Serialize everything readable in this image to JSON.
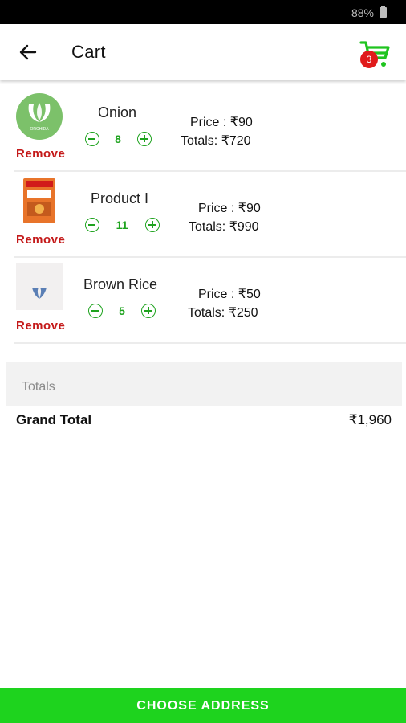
{
  "status_bar": {
    "battery": "88%"
  },
  "header": {
    "title": "Cart",
    "cart_badge": "3"
  },
  "items": [
    {
      "name": "Onion",
      "quantity": "8",
      "price": "Price : ₹90",
      "totals": "Totals: ₹720",
      "remove_label": "Remove",
      "logo_text": "ORCHIDA"
    },
    {
      "name": "Product I",
      "quantity": "11",
      "price": "Price : ₹90",
      "totals": "Totals: ₹990",
      "remove_label": "Remove"
    },
    {
      "name": "Brown Rice",
      "quantity": "5",
      "price": "Price : ₹50",
      "totals": "Totals: ₹250",
      "remove_label": "Remove"
    }
  ],
  "summary": {
    "section_label": "Totals",
    "grand_total_label": "Grand Total",
    "grand_total_value": "₹1,960"
  },
  "footer": {
    "button_label": "CHOOSE ADDRESS"
  },
  "colors": {
    "accent": "#1fa31f",
    "button": "#1ed31e",
    "remove": "#c41a1a",
    "badge": "#e01b1b"
  }
}
